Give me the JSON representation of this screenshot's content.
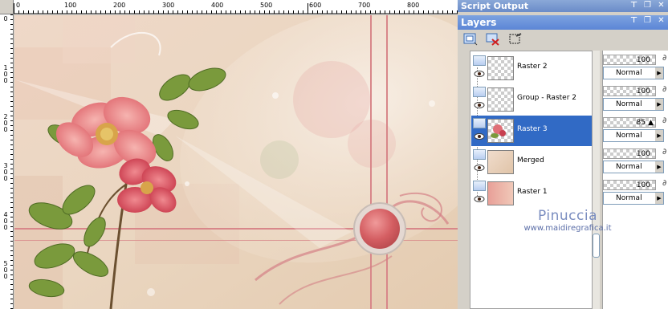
{
  "ruler": {
    "top_labels": [
      "0",
      "100",
      "200",
      "300",
      "400",
      "500",
      "600",
      "700",
      "800"
    ],
    "left_labels": [
      "0",
      "100",
      "200",
      "300",
      "400",
      "500"
    ]
  },
  "panels": {
    "script_output_title": "Script Output",
    "layers_title": "Layers"
  },
  "layers": [
    {
      "name": "Raster 2",
      "opacity": "100",
      "blend": "Normal",
      "selected": false,
      "thumb": "checker"
    },
    {
      "name": "Group - Raster 2",
      "opacity": "100",
      "blend": "Normal",
      "selected": false,
      "thumb": "checker"
    },
    {
      "name": "Raster 3",
      "opacity": "85",
      "blend": "Normal",
      "selected": true,
      "thumb": "flower"
    },
    {
      "name": "Merged",
      "opacity": "100",
      "blend": "Normal",
      "selected": false,
      "thumb": "merged"
    },
    {
      "name": "Raster 1",
      "opacity": "100",
      "blend": "Normal",
      "selected": false,
      "thumb": "pink"
    }
  ],
  "watermark": {
    "name": "Pinuccia",
    "url": "www.maidiregrafica.it"
  },
  "colors": {
    "selection": "#316ac5",
    "title_bar": "#5c86d6",
    "accent_pink": "#d87878"
  }
}
